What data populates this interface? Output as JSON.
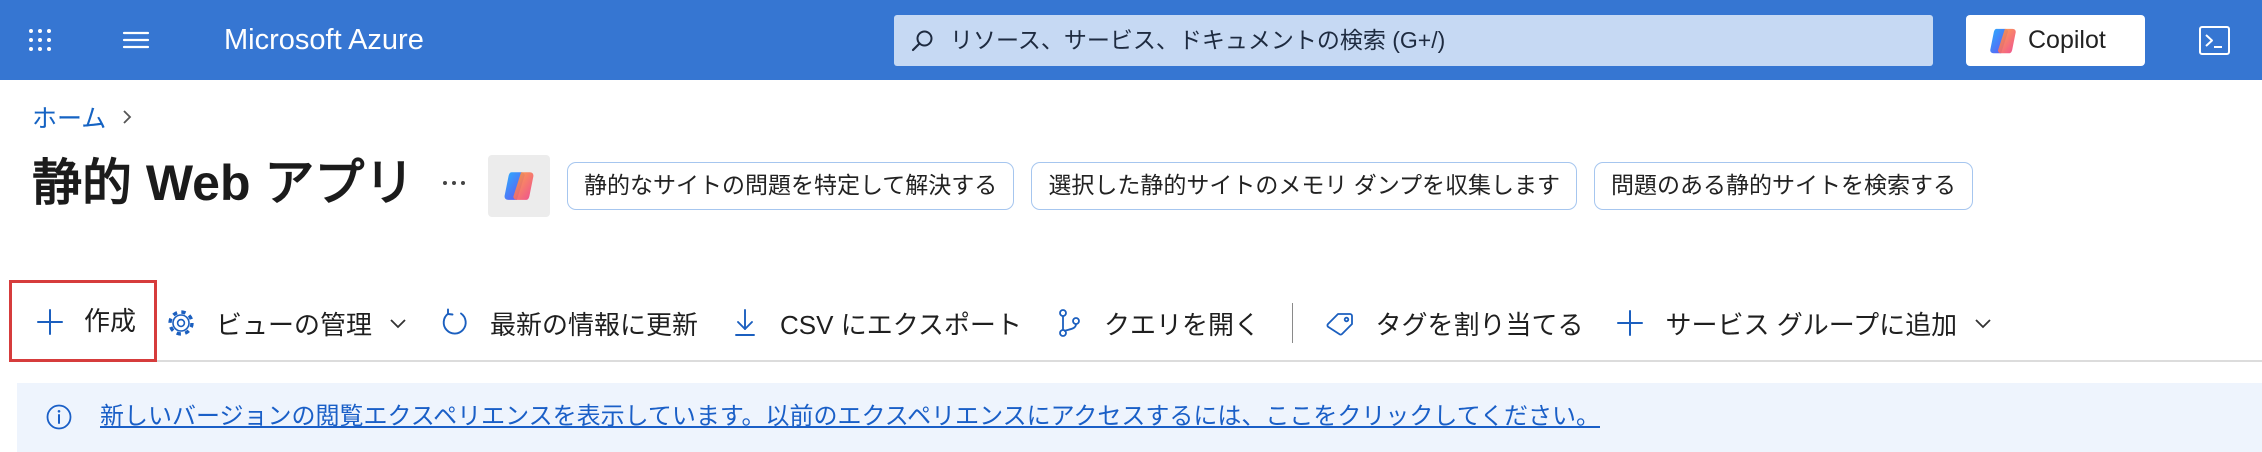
{
  "header": {
    "app_title": "Microsoft Azure",
    "search_placeholder": "リソース、サービス、ドキュメントの検索 (G+/)",
    "copilot_label": "Copilot"
  },
  "breadcrumb": {
    "home": "ホーム"
  },
  "page": {
    "title": "静的 Web アプリ"
  },
  "suggestions": [
    "静的なサイトの問題を特定して解決する",
    "選択した静的サイトのメモリ ダンプを収集します",
    "問題のある静的サイトを検索する"
  ],
  "toolbar": {
    "create": "作成",
    "manage_view": "ビューの管理",
    "refresh": "最新の情報に更新",
    "export_csv": "CSV にエクスポート",
    "open_query": "クエリを開く",
    "assign_tags": "タグを割り当てる",
    "add_service_group": "サービス グループに追加"
  },
  "banner": {
    "text": "新しいバージョンの閲覧エクスペリエンスを表示しています。以前のエクスペリエンスにアクセスするには、ここをクリックしてください。"
  },
  "icons": {
    "app_launcher": "grid-icon",
    "portal_menu": "hamburger-icon",
    "search": "search-icon",
    "copilot": "copilot-icon",
    "cloud_shell": "terminal-icon",
    "breadcrumb_separator": "chevron-right-icon",
    "more": "more-icon",
    "create": "plus-icon",
    "manage_view": "gear-icon",
    "refresh": "refresh-icon",
    "export": "download-icon",
    "open_query": "query-icon",
    "assign_tags": "tag-icon",
    "add_service_group": "plus-icon",
    "dropdown": "chevron-down-icon",
    "info": "info-icon"
  },
  "colors": {
    "header_background": "#3676d2",
    "link": "#1563c3",
    "highlight_border": "#d63c3c",
    "banner_background": "#eef4fd"
  }
}
